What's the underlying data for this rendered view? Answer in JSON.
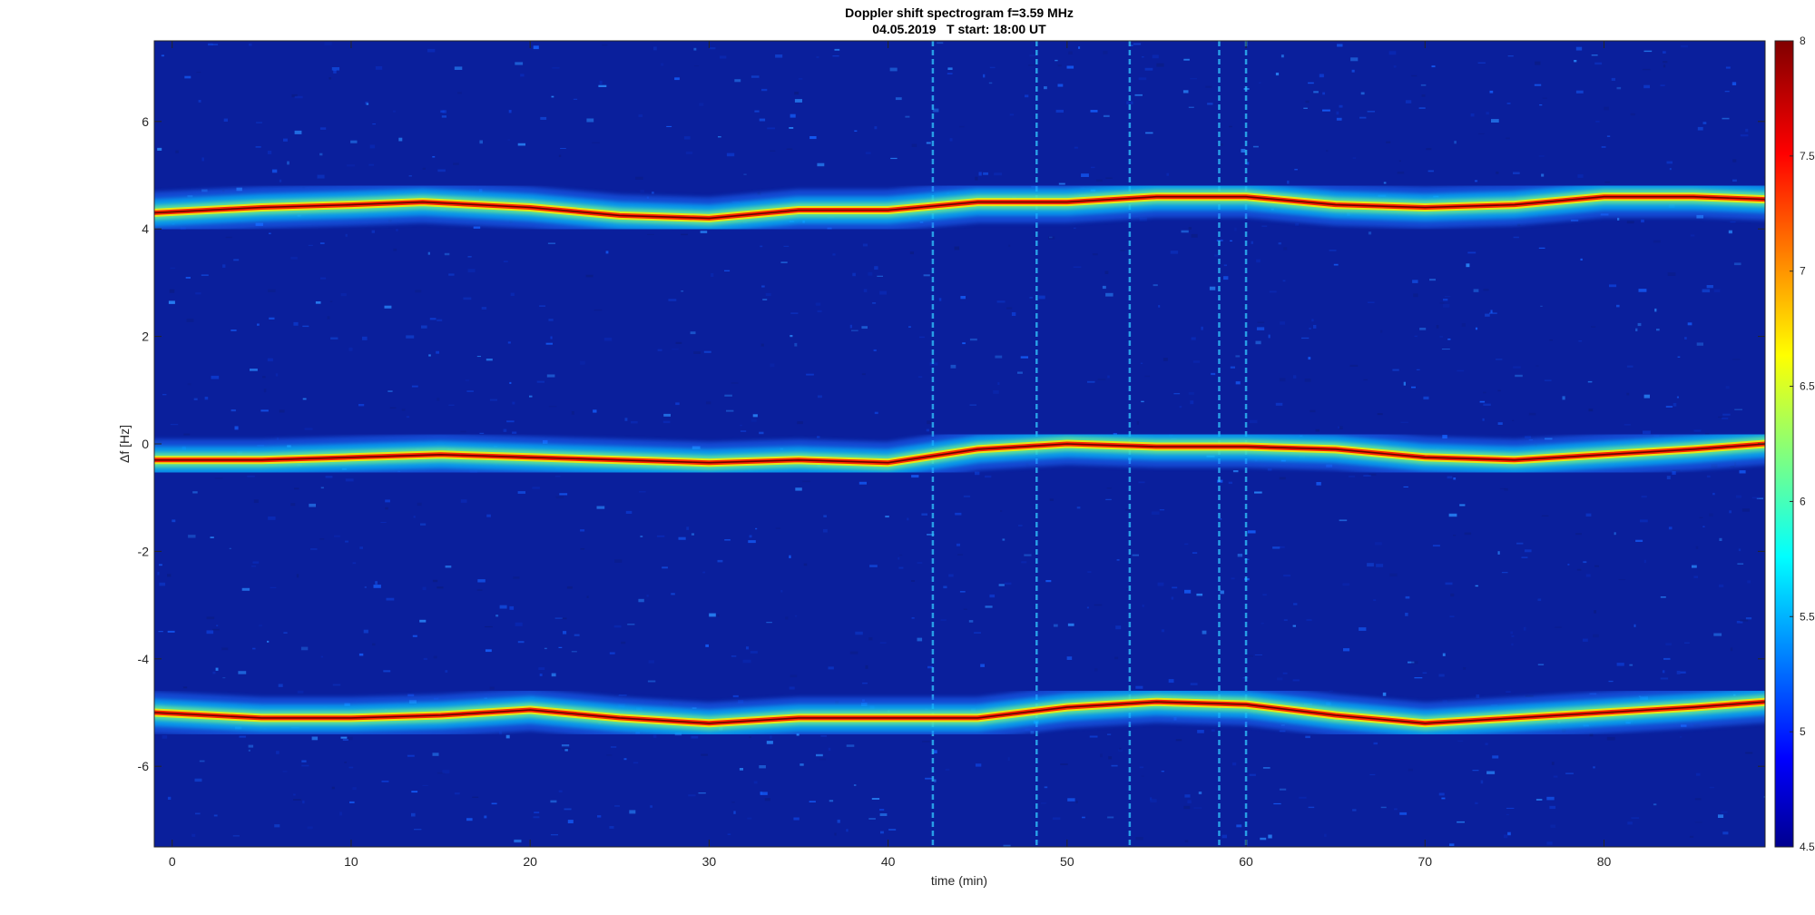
{
  "chart_data": {
    "type": "heatmap",
    "title": "Doppler shift spectrogram f=3.59 MHz",
    "subtitle": "04.05.2019   T start: 18:00 UT",
    "xlabel": "time (min)",
    "ylabel": "Δf [Hz]",
    "xlim": [
      -1,
      89
    ],
    "ylim": [
      -7.5,
      7.5
    ],
    "xticks": [
      0,
      10,
      20,
      30,
      40,
      50,
      60,
      70,
      80
    ],
    "yticks": [
      -6,
      -4,
      -2,
      0,
      2,
      4,
      6
    ],
    "colormap": "jet",
    "colorbar": {
      "range": [
        4.5,
        8
      ],
      "ticks": [
        "8",
        "7.5",
        "7",
        "6.5",
        "6",
        "5.5",
        "5",
        "4.5"
      ]
    },
    "traces": [
      {
        "x": [
          -1,
          5,
          10,
          14,
          20,
          25,
          30,
          35,
          40,
          45,
          50,
          55,
          60,
          65,
          70,
          75,
          80,
          85,
          89
        ],
        "y": [
          4.3,
          4.4,
          4.45,
          4.5,
          4.4,
          4.25,
          4.2,
          4.35,
          4.35,
          4.5,
          4.5,
          4.6,
          4.6,
          4.45,
          4.4,
          4.45,
          4.6,
          4.6,
          4.55
        ]
      },
      {
        "x": [
          -1,
          5,
          10,
          15,
          20,
          25,
          30,
          35,
          40,
          45,
          50,
          55,
          60,
          65,
          70,
          75,
          80,
          85,
          89
        ],
        "y": [
          -0.3,
          -0.3,
          -0.25,
          -0.2,
          -0.25,
          -0.3,
          -0.35,
          -0.3,
          -0.35,
          -0.1,
          0,
          -0.05,
          -0.05,
          -0.1,
          -0.25,
          -0.3,
          -0.2,
          -0.1,
          0
        ]
      },
      {
        "x": [
          -1,
          5,
          10,
          15,
          20,
          25,
          30,
          35,
          40,
          45,
          50,
          55,
          60,
          65,
          70,
          75,
          80,
          85,
          89
        ],
        "y": [
          -5.0,
          -5.1,
          -5.1,
          -5.05,
          -4.95,
          -5.1,
          -5.2,
          -5.1,
          -5.1,
          -5.1,
          -4.9,
          -4.8,
          -4.85,
          -5.05,
          -5.2,
          -5.1,
          -5.0,
          -4.9,
          -4.8
        ]
      }
    ],
    "vertical_streaks_x": [
      42.5,
      48.3,
      53.5,
      58.5,
      60
    ]
  }
}
